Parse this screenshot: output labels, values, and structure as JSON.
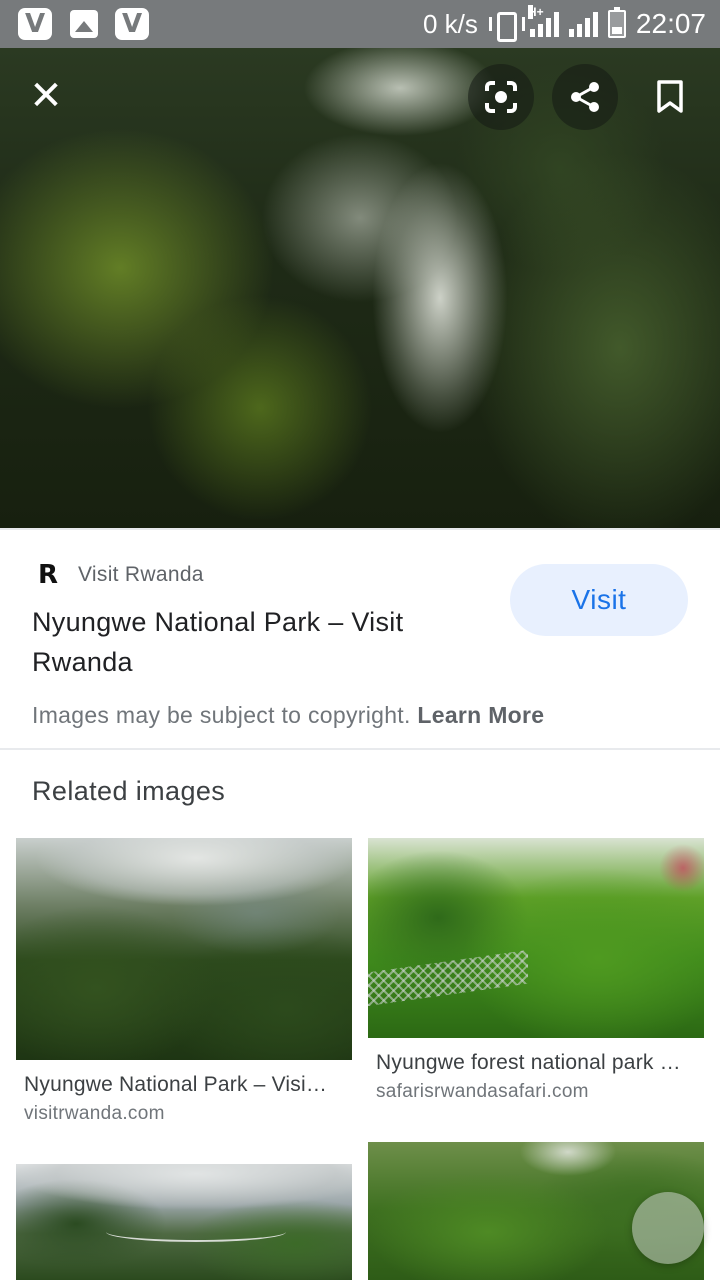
{
  "status_bar": {
    "app_icons": [
      "V",
      "V"
    ],
    "net_speed": "0 k/s",
    "network_type": "H+",
    "time": "22:07"
  },
  "viewer": {
    "close_icon": "close-icon",
    "lens_icon": "lens-icon",
    "share_icon": "share-icon",
    "bookmark_icon": "bookmark-icon"
  },
  "result": {
    "source_logo": "R",
    "source_name": "Visit Rwanda",
    "title": "Nyungwe National Park – Visit Rwanda",
    "visit_label": "Visit",
    "copyright_text": "Images may be subject to copyright.",
    "learn_more_label": "Learn More"
  },
  "related": {
    "heading": "Related images",
    "items": [
      {
        "title": "Nyungwe National Park – Visi…",
        "site": "visitrwanda.com"
      },
      {
        "title": "Nyungwe forest national park …",
        "site": "safarisrwandasafari.com"
      }
    ]
  },
  "colors": {
    "status_bar": "#777a7c",
    "visit_bg": "#e8f0fe",
    "visit_text": "#1a73e8"
  }
}
